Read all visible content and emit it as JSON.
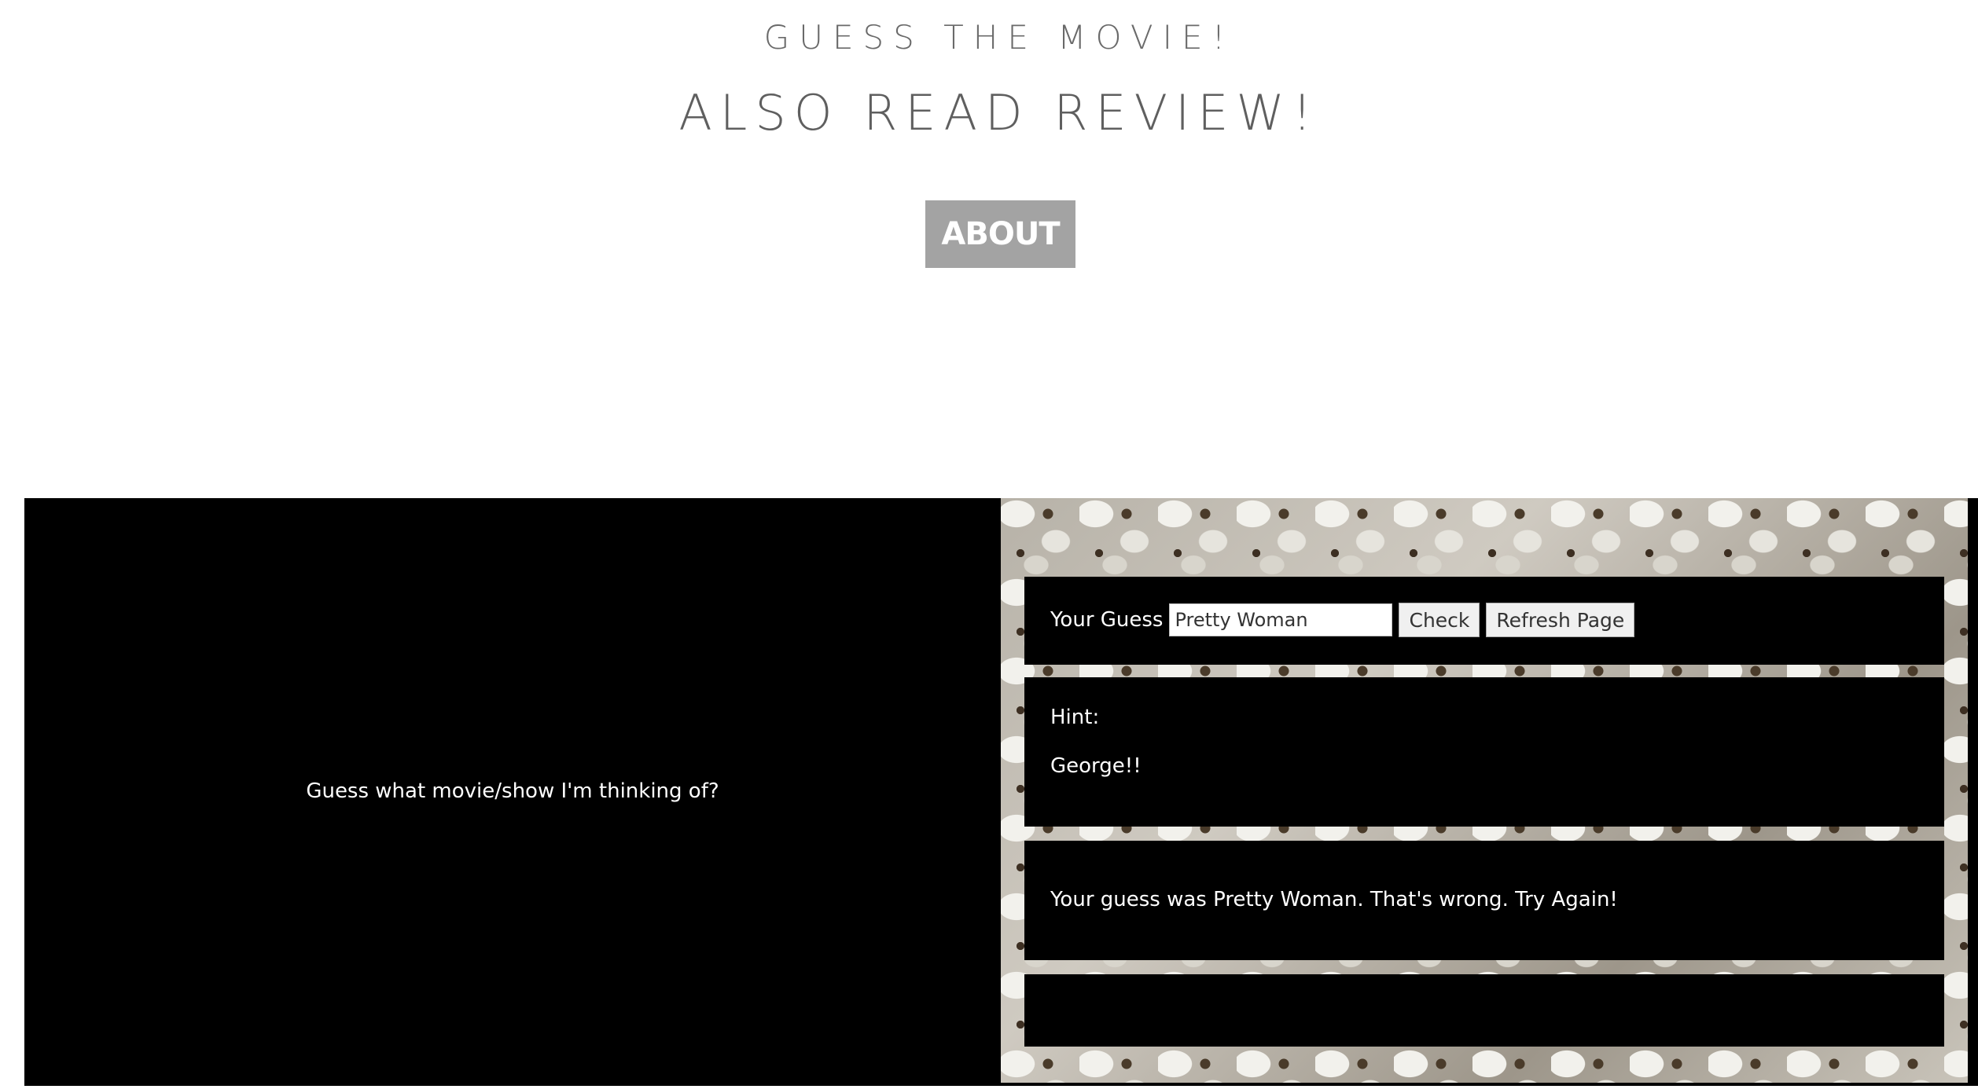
{
  "header": {
    "title": "GUESS THE MOVIE!",
    "subtitle": "ALSO READ REVIEW!",
    "about_label": "ABOUT"
  },
  "left": {
    "prompt": "Guess what movie/show I'm thinking of?"
  },
  "guess": {
    "label": "Your Guess",
    "input_value": "Pretty Woman",
    "check_label": "Check",
    "refresh_label": "Refresh Page"
  },
  "hint": {
    "label": "Hint:",
    "text": "George!!"
  },
  "result": {
    "text": "Your guess was Pretty Woman. That's wrong. Try Again!"
  },
  "colors": {
    "about_bg": "#a3a3a3",
    "panel_bg": "#000000",
    "title_text": "#6a6a6a"
  }
}
